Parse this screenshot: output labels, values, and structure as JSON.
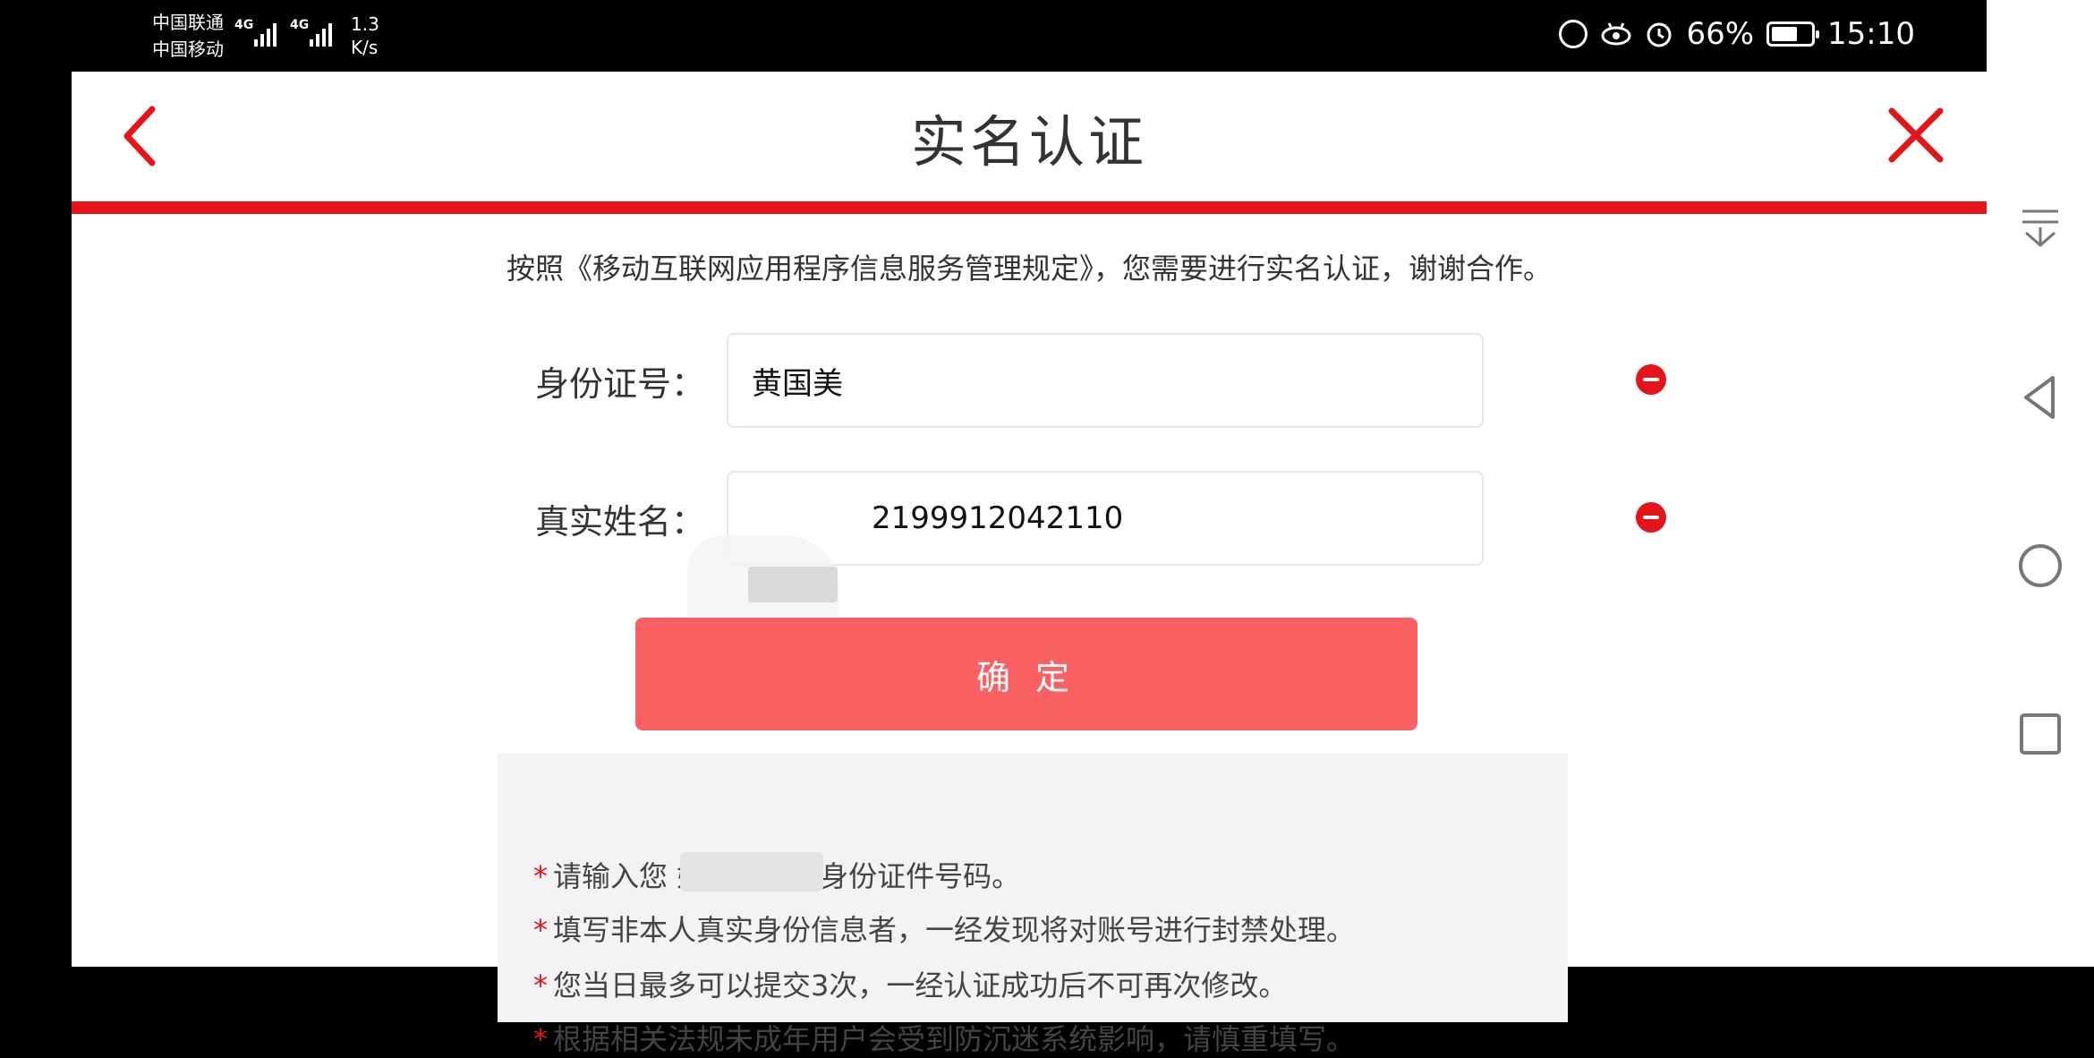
{
  "status_bar": {
    "carrier_1": "中国联通",
    "carrier_2": "中国移动",
    "network_1": "4G",
    "network_2": "4G",
    "speed_value": "1.3",
    "speed_unit": "K/s",
    "battery_percent": "66%",
    "battery_level": 0.66,
    "time": "15:10",
    "icons": [
      "hd-icon",
      "eye-comfort-icon",
      "alarm-icon",
      "battery-icon"
    ]
  },
  "header": {
    "title": "实名认证",
    "back_icon": "chevron-left-icon",
    "close_icon": "close-icon",
    "accent_color": "#e5141b"
  },
  "notice": "按照《移动互联网应用程序信息服务管理规定》，您需要进行实名认证，谢谢合作。",
  "form": {
    "id_label": "身份证号：",
    "id_value": "黄国美",
    "name_label": "真实姓名：",
    "name_value": "2199912042110",
    "clear_icon": "minus-circle-icon"
  },
  "confirm_label": "确 定",
  "confirm_color": "#fb6062",
  "tips": {
    "star": "*",
    "items": [
      "请输入您 姓名及有效身份证件号码。",
      "填写非本人真实身份信息者，一经发现将对账号进行封禁处理。",
      "您当日最多可以提交3次，一经认证成功后不可再次修改。",
      "根据相关法规未成年用户会受到防沉迷系统影响，请慎重填写。"
    ]
  },
  "nav_bar": {
    "icons": [
      "notification-pulldown-icon",
      "back-triangle-icon",
      "home-circle-icon",
      "recents-square-icon"
    ]
  }
}
